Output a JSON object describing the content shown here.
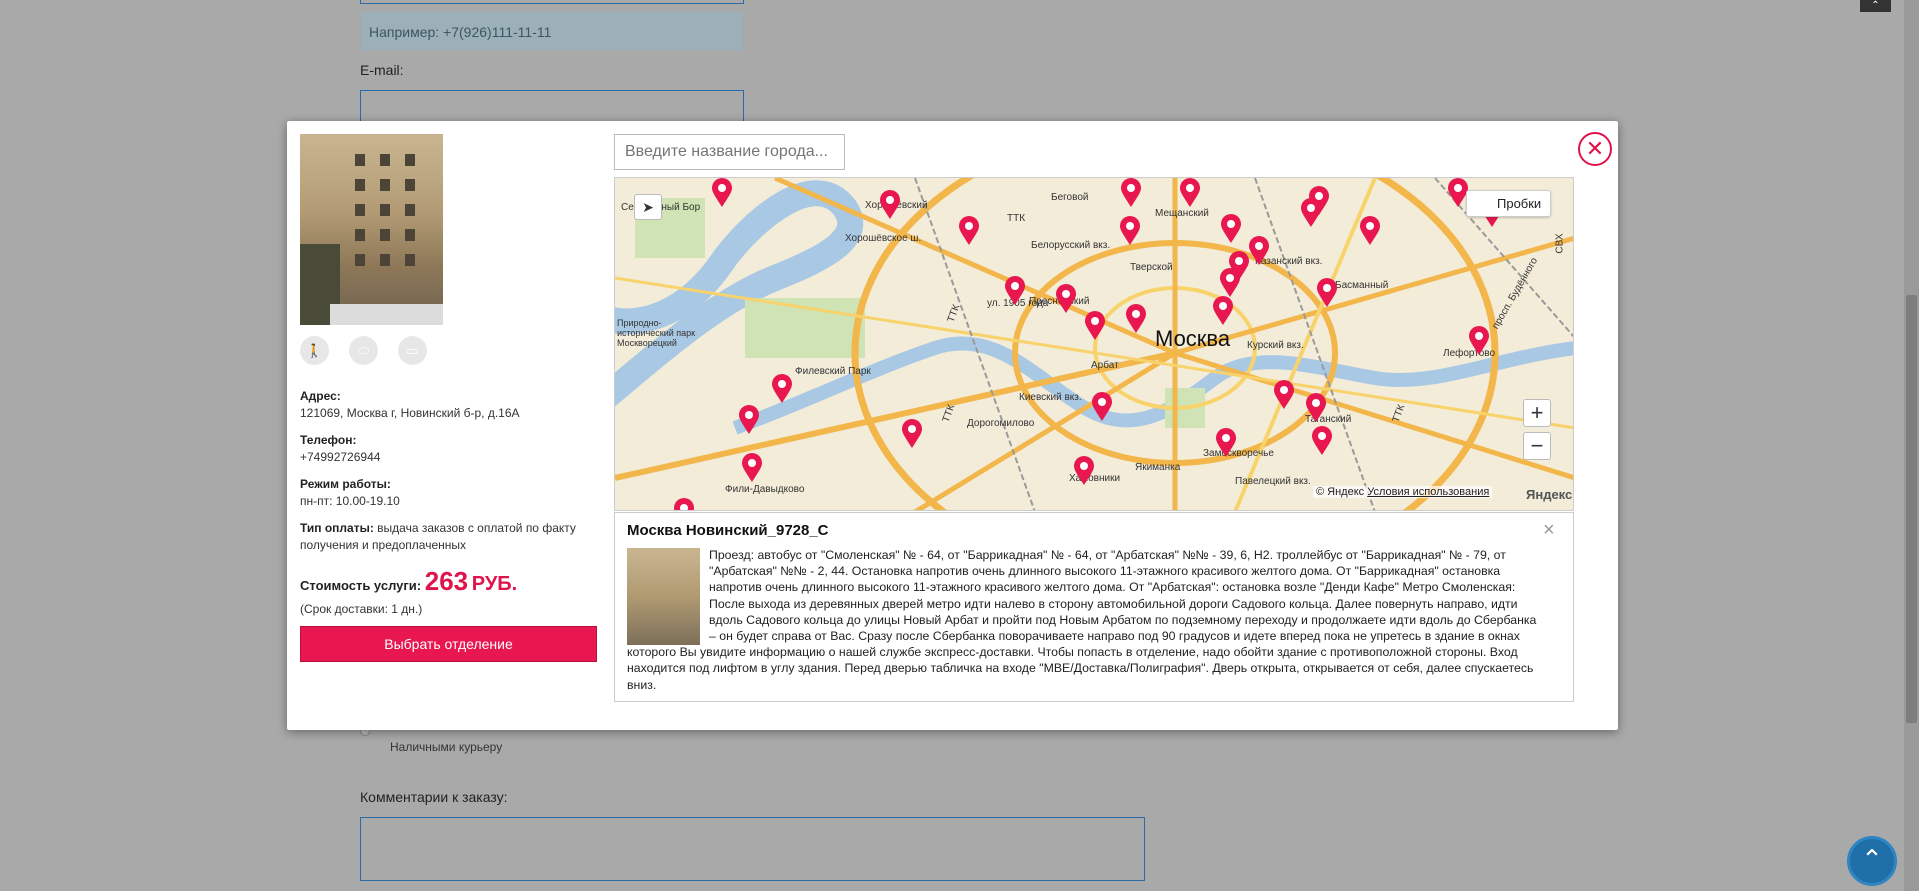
{
  "background": {
    "phone_placeholder": "Например: +7(926)111-11-11",
    "email_label": "E-mail:",
    "courier_label": "Наличными курьеру",
    "comment_label": "Комментарии к заказу:"
  },
  "modal": {
    "close_icon": "close-icon",
    "office": {
      "address_label": "Адрес:",
      "address_value": "121069, Москва г, Новинский б-р, д.16А",
      "phone_label": "Телефон:",
      "phone_value": "+74992726944",
      "hours_label": "Режим работы:",
      "hours_value": "пн-пт: 10.00-19.10",
      "payment_label": "Тип оплаты:",
      "payment_value": "выдача заказов с оплатой по факту получения и предоплаченных",
      "cost_label": "Стоимость услуги:",
      "cost_value": "263",
      "cost_currency": "РУБ.",
      "delivery_term": "(Срок доставки: 1 дн.)",
      "choose_button": "Выбрать отделение"
    },
    "city_search": {
      "placeholder": "Введите название города..."
    },
    "map": {
      "city_label": "Москва",
      "traffic_button": "Пробки",
      "zoom_in": "+",
      "zoom_out": "−",
      "copyright": "© Яндекс",
      "terms_link": "Условия использования",
      "logo": "Яндекс",
      "labels": {
        "serebryany_bor": "Серебряный Бор",
        "khoroshevsky": "Хорошёвский",
        "khoroshevskoe_sh": "Хорошёвское ш.",
        "begovoy": "Беговой",
        "ttk1": "ТТК",
        "ttk2": "ТТК",
        "ttk3": "ТТК",
        "ttk4": "ТТК",
        "belorussky": "Белорусский вкз.",
        "meshchansky": "Мещанский",
        "kazansky": "Казанский вкз.",
        "tverskoy": "Тверской",
        "basmanny": "Басманный",
        "presnensky": "Пресненский",
        "park_1905": "ул. 1905 года",
        "fili_reserve": "Природно-исторический парк Москворецкий",
        "filevsky_park": "Филевский Парк",
        "kursky": "Курский вкз.",
        "lefortovo": "Лефортово",
        "arbat": "Арбат",
        "kievsky": "Киевский вкз.",
        "dorogomilovo": "Дорогомилово",
        "tagansky": "Таганский",
        "zamoskvorechye": "Замоскворечье",
        "khamovniki": "Хамовники",
        "yakimanka": "Якиманка",
        "paveletsky": "Павелецкий вкз.",
        "fili_davydkovo": "Фили-Давыдково",
        "budennogo": "просп. Будённого",
        "svkh": "СВХ"
      }
    },
    "detail": {
      "title": "Москва Новинский_9728_С",
      "close": "×",
      "text": "Проезд: автобус от \"Смоленская\" № - 64, от \"Баррикадная\" № - 64, от \"Арбатская\" №№ - 39, 6, Н2. троллейбус от \"Баррикадная\" № - 79, от \"Арбатская\" №№ - 2, 44. Остановка напротив очень длинного высокого 11-этажного красивого желтого дома. От \"Баррикадная\" остановка напротив очень длинного высокого 11-этажного красивого желтого дома. От \"Арбатская\": остановка возле \"Денди Кафе\" Метро Смоленская: После выхода из деревянных дверей метро идти налево в сторону автомобильной дороги Садового кольца. Далее повернуть направо, идти вдоль Садового кольца до улицы Новый Арбат и пройти под Новым Арбатом по подземному переходу и продолжаете идти вдоль до Сбербанка – он будет справа от Вас. Сразу после Сбербанка поворачиваете направо под 90 градусов и идете вперед пока не упретесь в здание в окнах которого Вы увидите информацию о нашей службе экспресс-доставки. Чтобы попасть в отделение, надо обойти здание с противоположной стороны. Вход находится под лифтом в углу здания. Перед дверью табличка на входе \"МВЕ/Доставка/Полиграфия\". Дверь открыта, открывается от себя, далее спускаетесь вниз."
    }
  },
  "colors": {
    "accent": "#e8174f",
    "overlay": "#a9a9a9",
    "link_blue": "#2b6ca8"
  }
}
